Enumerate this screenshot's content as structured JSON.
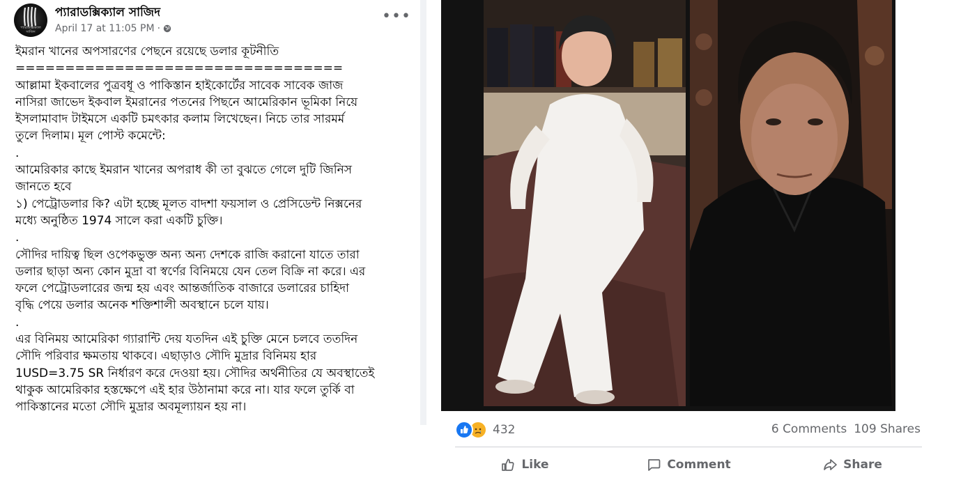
{
  "post": {
    "author": "প্যারাডক্সিক্যাল সাজিদ",
    "timestamp": "April 17 at 11:05 PM",
    "meta_separator": "·",
    "more_label": "•••",
    "avatar_text": "প্যারাডক্সিক্যাল সাজিদ",
    "body_lines": [
      "ইমরান খানের অপসারণের পেছনে রয়েছে ডলার কূটনীতি",
      "=================================",
      "আল্লামা ইকবালের পুত্রবধূ ও পাকিস্তান হাইকোর্টের সাবেক সাবেক জাজ",
      "নাসিরা জাভেদ ইকবাল ইমরানের পতনের পিছনে আমেরিকান ভূমিকা নিয়ে",
      "ইসলামাবাদ টাইমসে একটি চমৎকার কলাম লিখেছেন। নিচে তার সারমর্ম",
      "তুলে দিলাম। মূল পোস্ট কমেন্টে:",
      ".",
      "আমেরিকার কাছে ইমরান খানের অপরাধ কী তা বুঝতে গেলে দুটি জিনিস",
      "জানতে হবে",
      "১) পেট্রোডলার কি? এটা হচ্ছে মূলত বাদশা ফয়সাল ও প্রেসিডেন্ট নিক্সনের",
      "মধ্যে অনুষ্ঠিত 1974 সালে করা একটি চুক্তি।",
      ".",
      "সৌদির দায়িত্ব ছিল ওপেকভুক্ত অন্য অন্য দেশকে রাজি করানো যাতে তারা",
      "ডলার ছাড়া অন্য কোন মুদ্রা বা স্বর্ণের বিনিময়ে যেন তেল বিক্রি না করে। এর",
      "ফলে পেট্রোডলারের জন্ম হয় এবং আন্তর্জাতিক বাজারে ডলারের চাহিদা",
      "বৃদ্ধি পেয়ে ডলার অনেক শক্তিশালী অবস্থানে চলে যায়।",
      ".",
      "এর বিনিময় আমেরিকা গ্যারান্টি দেয় যতদিন এই চুক্তি মেনে চলবে ততদিন",
      "সৌদি পরিবার ক্ষমতায় থাকবে। এছাড়াও সৌদি মুদ্রার বিনিময় হার",
      "1USD=3.75 SR নির্ধারণ করে দেওয়া হয়। সৌদির অর্থনীতির যে অবস্থাতেই",
      "থাকুক আমেরিকার হস্তক্ষেপে এই হার উঠানামা করে না। যার ফলে তুর্কি বা",
      "পাকিস্তানের মতো সৌদি মুদ্রার অবমূল্যায়ন হয় না।",
      "."
    ]
  },
  "photo_post": {
    "reaction_count": "432",
    "comments": "6 Comments",
    "shares": "109 Shares",
    "actions": {
      "like": "Like",
      "comment": "Comment",
      "share": "Share"
    }
  },
  "colors": {
    "facebook_blue": "#1877f2",
    "secondary_text": "#65676b",
    "divider": "#ced0d4",
    "photo_background": "#121212"
  }
}
